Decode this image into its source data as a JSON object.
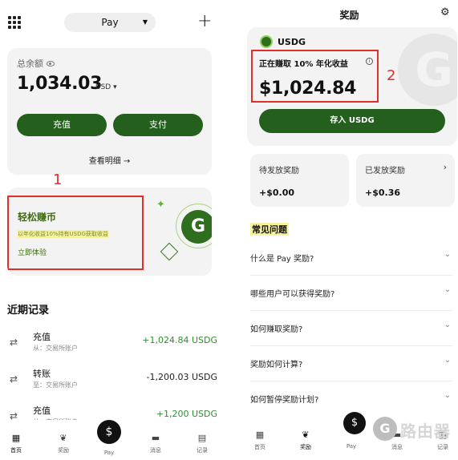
{
  "left": {
    "header": {
      "pay_label": "Pay"
    },
    "balance": {
      "label": "总余额",
      "amount": "1,034.03",
      "unit": "USD ▾",
      "deposit_label": "充值",
      "pay_label": "支付",
      "detail_link": "查看明细 →"
    },
    "promo": {
      "title": "轻松赚币",
      "subtitle": "以年化收益10%持有USDG获取收益",
      "cta": "立即体验",
      "annotation_number": "1"
    },
    "recent": {
      "title": "近期记录",
      "items": [
        {
          "name": "充值",
          "from": "从：交易所账户",
          "amount": "+1,024.84 USDG",
          "positive": true
        },
        {
          "name": "转账",
          "from": "至：交易所账户",
          "amount": "-1,200.03 USDG",
          "positive": false
        },
        {
          "name": "充值",
          "from": "从：交易所账户",
          "amount": "+1,200 USDG",
          "positive": true
        }
      ]
    },
    "tabs": [
      "首页",
      "奖励",
      "Pay",
      "消息",
      "记录"
    ],
    "pay_fab": "$"
  },
  "right": {
    "title": "奖励",
    "earn": {
      "coin": "USDG",
      "rate_text": "正在赚取 10% 年化收益",
      "info_icon": "i",
      "amount": "$1,024.84",
      "deposit_button": "存入 USDG",
      "annotation_number": "2"
    },
    "pending": {
      "label": "待发放奖励",
      "value": "+$0.00"
    },
    "paid": {
      "label": "已发放奖励",
      "value": "+$0.36",
      "chevron": "›"
    },
    "faq": {
      "title": "常见问题",
      "items": [
        "什么是 Pay 奖励?",
        "哪些用户可以获得奖励?",
        "如何赚取奖励?",
        "奖励如何计算?",
        "如何暂停奖励计划?"
      ]
    },
    "tabs": [
      "首页",
      "奖励",
      "Pay",
      "消息",
      "记录"
    ],
    "pay_fab": "$",
    "watermark": {
      "text": "路由器",
      "logo_glyph": "G"
    }
  },
  "icons": {
    "swap": "⇄",
    "chevron_down": "⌄",
    "gear": "⚙",
    "deco_logo_glyph": "G",
    "deco_star": "✦"
  }
}
